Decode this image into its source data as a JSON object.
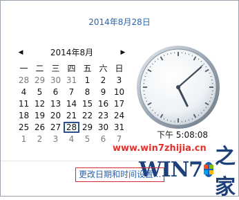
{
  "header": {
    "date_text": "2014年8月28日"
  },
  "calendar": {
    "month_label": "2014年8月",
    "prev_icon": "triangle-left-icon",
    "next_icon": "triangle-right-icon",
    "weekdays": [
      "一",
      "二",
      "三",
      "四",
      "五",
      "六",
      "日"
    ],
    "weeks": [
      [
        "28",
        "29",
        "30",
        "31",
        "1",
        "2",
        "3"
      ],
      [
        "4",
        "5",
        "6",
        "7",
        "8",
        "9",
        "10"
      ],
      [
        "11",
        "12",
        "13",
        "14",
        "15",
        "16",
        "17"
      ],
      [
        "18",
        "19",
        "20",
        "21",
        "22",
        "23",
        "24"
      ],
      [
        "25",
        "26",
        "27",
        "28",
        "29",
        "30",
        "31"
      ],
      [
        "1",
        "2",
        "3",
        "4",
        "5",
        "6",
        "7"
      ]
    ],
    "selected_day": "28"
  },
  "clock": {
    "time_text": "下午 5:08:08",
    "hour": 5,
    "minute": 8,
    "second": 8
  },
  "footer": {
    "settings_link": "更改日期和时间设置..."
  },
  "watermark": {
    "url": "www.win7zhijia.cn",
    "logo_text": "Win7之家"
  },
  "colors": {
    "accent": "#2b63ad",
    "today_border": "#2c4f8a",
    "link_border": "#d2282e"
  }
}
